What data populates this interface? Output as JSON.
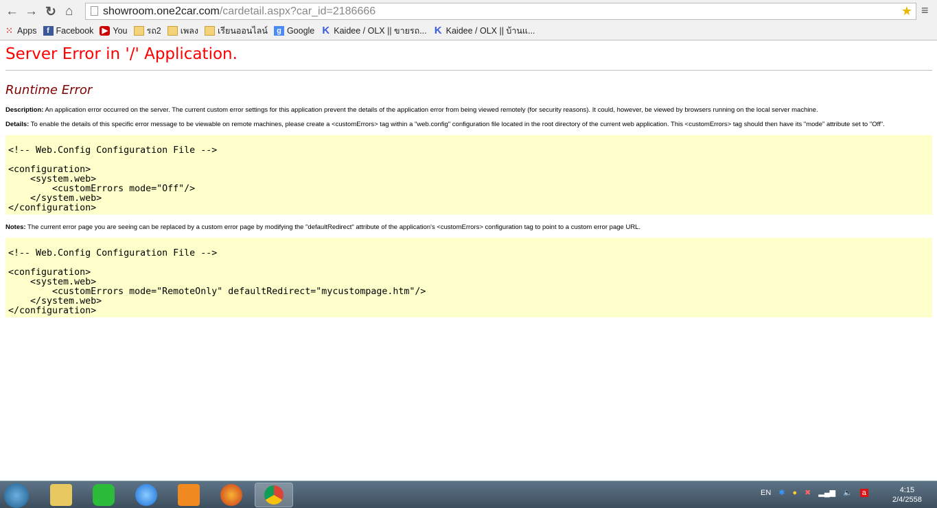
{
  "browser": {
    "url_host": "showroom.one2car.com",
    "url_path": "/cardetail.aspx?car_id=2186666",
    "bookmarks": [
      {
        "label": "Apps",
        "icon": "apps-icon"
      },
      {
        "label": "Facebook",
        "icon": "facebook-icon"
      },
      {
        "label": "You",
        "icon": "youtube-icon"
      },
      {
        "label": "รถ2",
        "icon": "folder-icon"
      },
      {
        "label": "เพลง",
        "icon": "folder-icon"
      },
      {
        "label": "เรียนออนไลน์",
        "icon": "folder-icon"
      },
      {
        "label": "Google",
        "icon": "google-icon"
      },
      {
        "label": "Kaidee / OLX || ขายรถ...",
        "icon": "kaidee-icon"
      },
      {
        "label": "Kaidee / OLX || บ้านแ...",
        "icon": "kaidee-icon"
      }
    ]
  },
  "page": {
    "title": "Server Error in '/' Application.",
    "subtitle": "Runtime Error",
    "description_label": "Description:",
    "description": " An application error occurred on the server. The current custom error settings for this application prevent the details of the application error from being viewed remotely (for security reasons). It could, however, be viewed by browsers running on the local server machine.",
    "details_label": "Details:",
    "details": " To enable the details of this specific error message to be viewable on remote machines, please create a <customErrors> tag within a \"web.config\" configuration file located in the root directory of the current web application. This <customErrors> tag should then have its \"mode\" attribute set to \"Off\".",
    "code1": "<!-- Web.Config Configuration File -->\n\n<configuration>\n    <system.web>\n        <customErrors mode=\"Off\"/>\n    </system.web>\n</configuration>",
    "notes_label": "Notes:",
    "notes": " The current error page you are seeing can be replaced by a custom error page by modifying the \"defaultRedirect\" attribute of the application's <customErrors> configuration tag to point to a custom error page URL.",
    "code2": "<!-- Web.Config Configuration File -->\n\n<configuration>\n    <system.web>\n        <customErrors mode=\"RemoteOnly\" defaultRedirect=\"mycustompage.htm\"/>\n    </system.web>\n</configuration>"
  },
  "taskbar": {
    "language": "EN",
    "time": "4:15",
    "date": "2/4/2558",
    "apps": [
      "explorer",
      "line",
      "internet-explorer",
      "media-player",
      "firefox",
      "chrome"
    ]
  },
  "colors": {
    "error_title": "#ff0000",
    "subtitle": "#800000",
    "code_bg": "#ffffcc"
  }
}
